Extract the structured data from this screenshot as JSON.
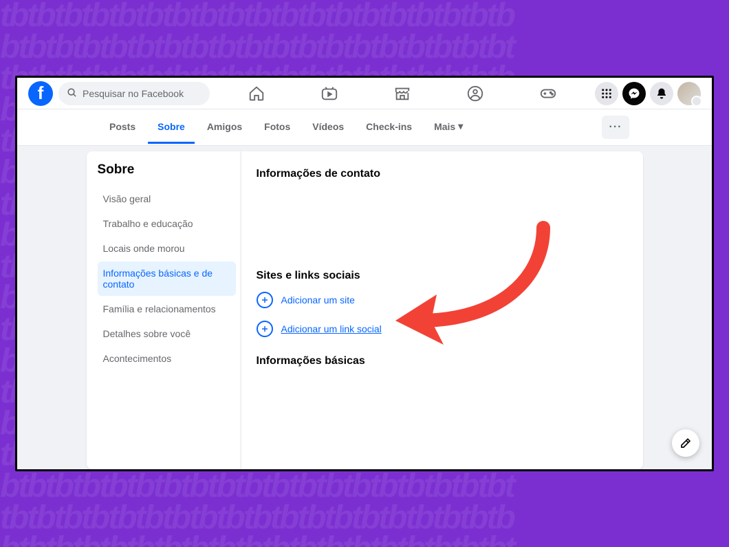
{
  "search": {
    "placeholder": "Pesquisar no Facebook"
  },
  "topnav_icons": [
    "home-icon",
    "video-icon",
    "marketplace-icon",
    "groups-icon",
    "gaming-icon"
  ],
  "right_icons": [
    "menu-grid-icon",
    "messenger-icon",
    "bell-icon",
    "avatar"
  ],
  "profile_tabs": {
    "items": [
      "Posts",
      "Sobre",
      "Amigos",
      "Fotos",
      "Vídeos",
      "Check-ins"
    ],
    "more_label": "Mais",
    "active_index": 1
  },
  "about": {
    "title": "Sobre",
    "sidebar": {
      "items": [
        "Visão geral",
        "Trabalho e educação",
        "Locais onde morou",
        "Informações básicas e de contato",
        "Família e relacionamentos",
        "Detalhes sobre você",
        "Acontecimentos"
      ],
      "active_index": 3
    },
    "sections": {
      "contact_title": "Informações de contato",
      "social_title": "Sites e links sociais",
      "add_site_label": "Adicionar um site",
      "add_social_label": "Adicionar um link social",
      "basic_title": "Informações básicas"
    }
  },
  "colors": {
    "accent": "#0866ff",
    "text_muted": "#65676b",
    "bg_page": "#7b2fd1"
  },
  "annotation": {
    "type": "arrow",
    "color": "#f24236",
    "target": "add-social-link"
  }
}
